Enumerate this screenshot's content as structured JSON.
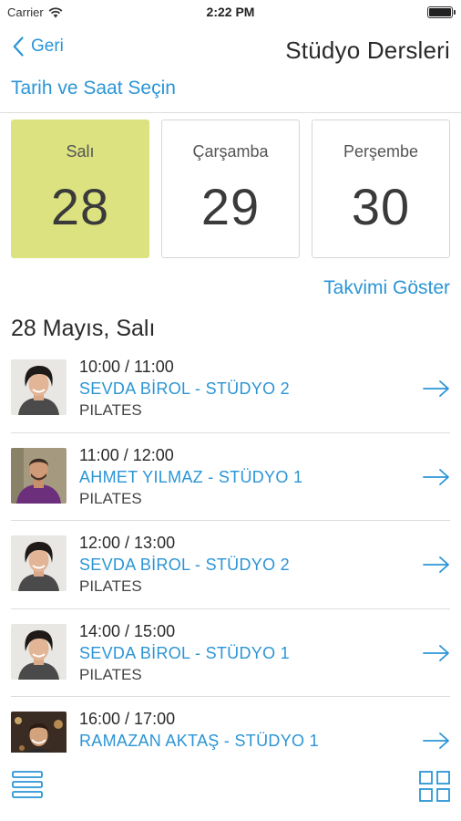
{
  "status_bar": {
    "carrier": "Carrier",
    "time": "2:22 PM",
    "battery_level": 1.0
  },
  "nav": {
    "back_label": "Geri",
    "title": "Stüdyo Dersleri"
  },
  "section": {
    "heading": "Tarih ve Saat Seçin"
  },
  "days": [
    {
      "name": "Salı",
      "number": "28",
      "selected": true
    },
    {
      "name": "Çarşamba",
      "number": "29",
      "selected": false
    },
    {
      "name": "Perşembe",
      "number": "30",
      "selected": false
    }
  ],
  "calendar_link": "Takvimi Göster",
  "date_heading": "28 Mayıs, Salı",
  "classes": [
    {
      "time": "10:00 / 11:00",
      "instructor": "SEVDA BİROL - STÜDYO 2",
      "category": "PILATES",
      "avatar": "female-instructor-avatar"
    },
    {
      "time": "11:00 / 12:00",
      "instructor": "AHMET YILMAZ - STÜDYO 1",
      "category": "PILATES",
      "avatar": "male-instructor-avatar"
    },
    {
      "time": "12:00 / 13:00",
      "instructor": "SEVDA BİROL - STÜDYO 2",
      "category": "PILATES",
      "avatar": "female-instructor-avatar"
    },
    {
      "time": "14:00 / 15:00",
      "instructor": "SEVDA BİROL - STÜDYO 1",
      "category": "PILATES",
      "avatar": "female-instructor-avatar"
    },
    {
      "time": "16:00 / 17:00",
      "instructor": "RAMAZAN AKTAŞ - STÜDYO 1",
      "category": "",
      "avatar": "male-instructor-avatar"
    }
  ],
  "icons": {
    "back": "chevron-left-icon",
    "row_arrow": "arrow-right-icon",
    "list_view": "list-view-icon",
    "grid_view": "grid-view-icon",
    "wifi": "wifi-icon",
    "battery": "battery-icon"
  },
  "colors": {
    "accent": "#2b95d6",
    "selected_day": "#dbe27f",
    "text": "#2a2a2a",
    "divider": "#dddddd"
  }
}
